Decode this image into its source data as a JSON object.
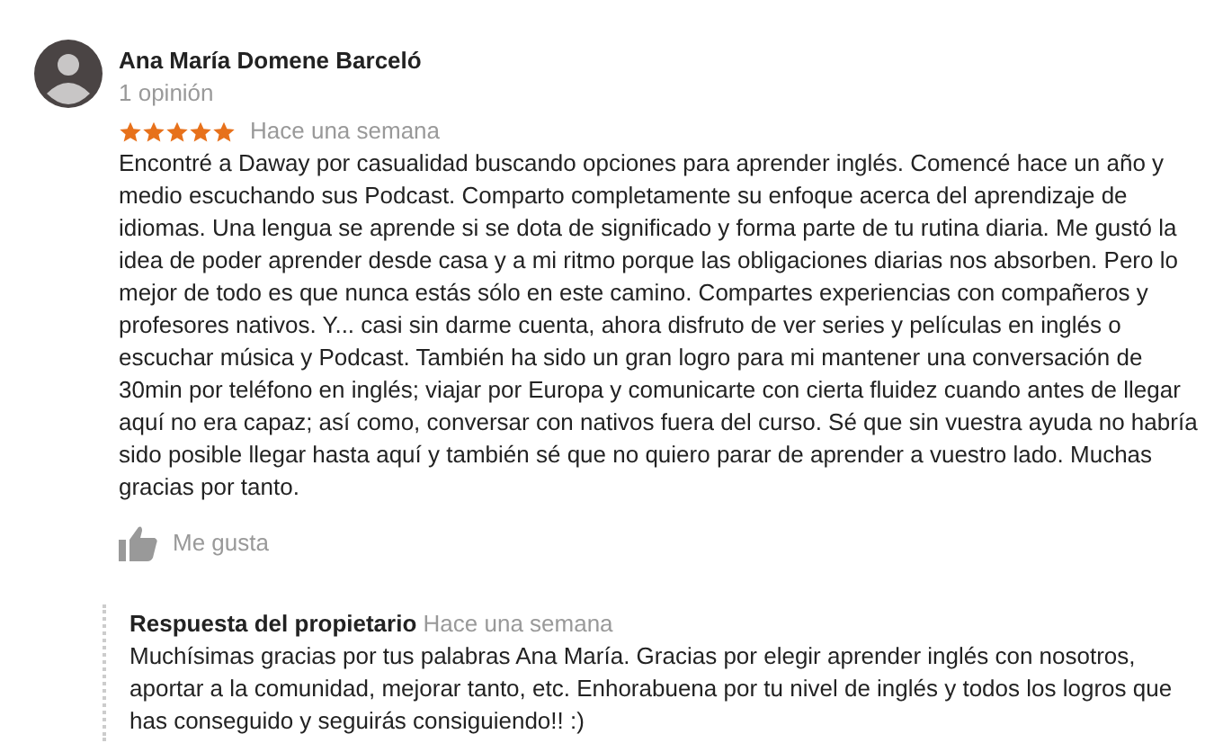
{
  "review": {
    "author": "Ana María Domene Barceló",
    "count": "1 opinión",
    "stars": 5,
    "time": "Hace una semana",
    "text": "Encontré a Daway por casualidad buscando opciones para aprender inglés. Comencé hace un año y medio escuchando sus Podcast. Comparto completamente su enfoque acerca del aprendizaje de idiomas. Una lengua se aprende si se dota de significado y forma parte de tu rutina diaria. Me gustó la idea de poder aprender desde casa y a mi ritmo porque las obligaciones diarias nos absorben. Pero lo mejor de todo es que nunca estás sólo en este camino. Compartes experiencias con compañeros y profesores nativos. Y... casi sin darme cuenta, ahora disfruto de ver series y películas en inglés o escuchar música y Podcast. También ha sido un gran logro para mi mantener una conversación de 30min por teléfono en inglés; viajar por Europa y comunicarte con cierta fluidez cuando antes de llegar aquí no era capaz; así como, conversar con nativos fuera del curso. Sé que sin vuestra ayuda no habría sido posible llegar hasta aquí y también sé que no quiero parar de aprender a vuestro lado. Muchas gracias por tanto.",
    "like": "Me gusta"
  },
  "reply": {
    "title": "Respuesta del propietario",
    "time": "Hace una semana",
    "text": "Muchísimas gracias por tus palabras Ana María. Gracias por elegir aprender inglés con nosotros, aportar a la comunidad, mejorar tanto, etc. Enhorabuena por tu nivel de inglés y todos los logros que has conseguido y seguirás consiguiendo!! :)"
  }
}
